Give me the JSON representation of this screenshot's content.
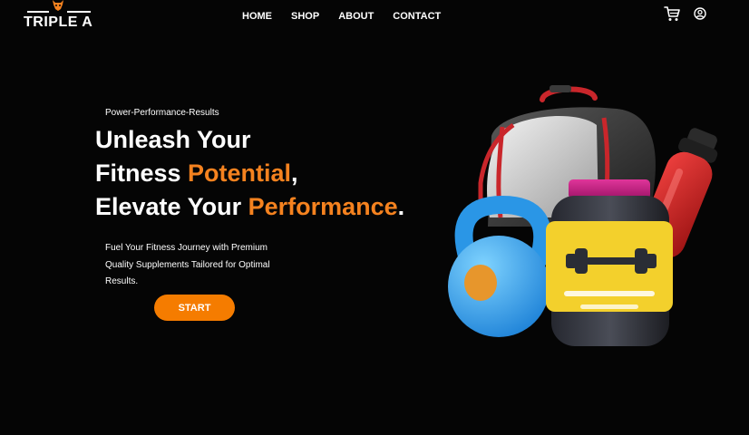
{
  "brand": {
    "name": "TRIPLE A",
    "accent_color": "#f5821f"
  },
  "nav": {
    "items": [
      {
        "label": "HOME"
      },
      {
        "label": "SHOP"
      },
      {
        "label": "ABOUT"
      },
      {
        "label": "CONTACT"
      }
    ]
  },
  "header_icons": {
    "cart": "cart-icon",
    "account": "user-circle-icon"
  },
  "hero": {
    "tagline": "Power-Performance-Results",
    "headline": {
      "line1": "Unleash Your",
      "line2_prefix": "Fitness ",
      "line2_accent": "Potential",
      "line2_suffix": ",",
      "line3_prefix": "Elevate Your ",
      "line3_accent": "Performance",
      "line3_suffix": "."
    },
    "description": "Fuel Your Fitness Journey with Premium Quality Supplements Tailored for Optimal Results.",
    "cta_label": "START",
    "cta_color": "#f57c00",
    "illustration_icons": [
      "gym-bag-icon",
      "water-bottle-icon",
      "kettlebell-icon",
      "supplement-jar-icon"
    ]
  }
}
